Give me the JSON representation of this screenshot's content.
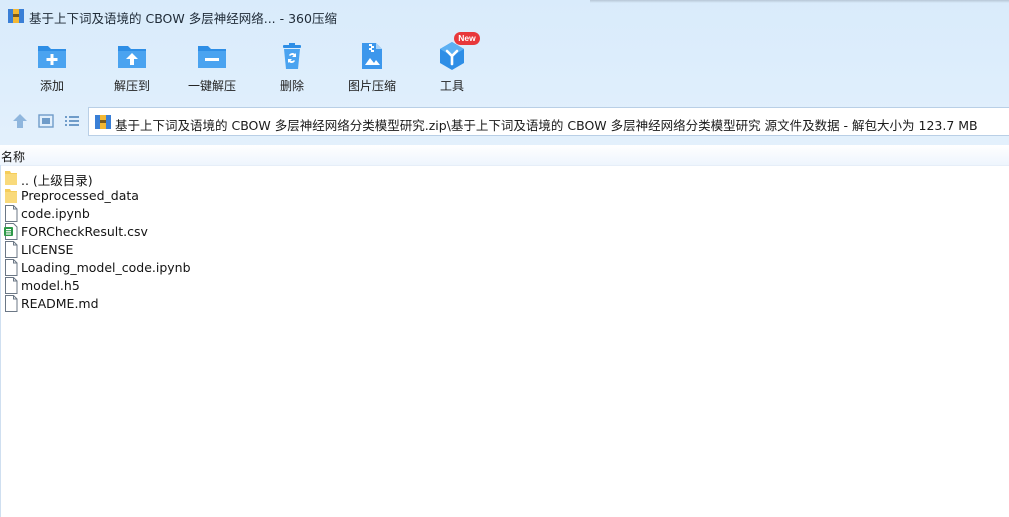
{
  "window": {
    "title": "基于上下词及语境的 CBOW 多层神经网络... - 360压缩"
  },
  "toolbar": {
    "buttons": [
      {
        "label": "添加",
        "icon": "add-folder-icon"
      },
      {
        "label": "解压到",
        "icon": "extract-to-folder-icon"
      },
      {
        "label": "一键解压",
        "icon": "one-click-extract-folder-icon"
      },
      {
        "label": "删除",
        "icon": "recycle-bin-icon"
      },
      {
        "label": "图片压缩",
        "icon": "image-compress-icon"
      },
      {
        "label": "工具",
        "icon": "tools-hexagon-icon"
      }
    ],
    "new_badge": "New"
  },
  "nav": {
    "up_icon": "up-arrow-icon",
    "view_icon": "view-mode-icon",
    "list_icon": "list-view-icon",
    "address": "基于上下词及语境的 CBOW 多层神经网络分类模型研究.zip\\基于上下词及语境的 CBOW 多层神经网络分类模型研究 源文件及数据 - 解包大小为 123.7 MB"
  },
  "file_list": {
    "column_name": "名称",
    "items": [
      {
        "name": ".. (上级目录)",
        "type": "folder"
      },
      {
        "name": "Preprocessed_data",
        "type": "folder"
      },
      {
        "name": "code.ipynb",
        "type": "file"
      },
      {
        "name": "FORCheckResult.csv",
        "type": "csv"
      },
      {
        "name": "LICENSE",
        "type": "file"
      },
      {
        "name": "Loading_model_code.ipynb",
        "type": "file"
      },
      {
        "name": "model.h5",
        "type": "file"
      },
      {
        "name": "README.md",
        "type": "file"
      }
    ]
  },
  "colors": {
    "accent_blue": "#2f8fe3",
    "header_bg": "#dcedfb",
    "badge_red": "#e8383b"
  }
}
